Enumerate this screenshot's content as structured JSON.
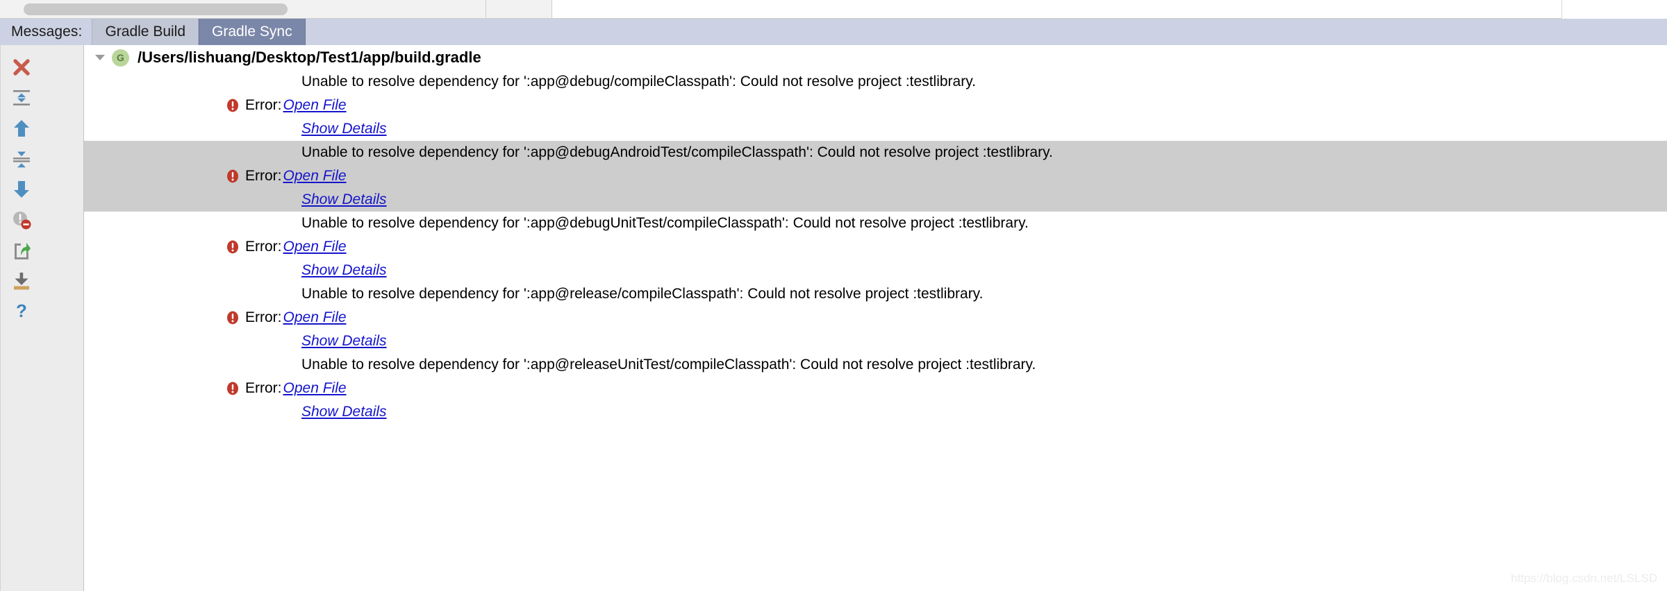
{
  "window": {
    "top_strip": {
      "pill_placeholder": ""
    }
  },
  "tabbar": {
    "label": "Messages:",
    "tabs": [
      {
        "label": "Gradle Build",
        "active": false
      },
      {
        "label": "Gradle Sync",
        "active": true
      }
    ]
  },
  "toolbar": {
    "items": [
      {
        "name": "close-icon",
        "tooltip": "Close"
      },
      {
        "name": "expand-all-icon",
        "tooltip": "Expand All"
      },
      {
        "name": "previous-occurrence-icon",
        "tooltip": "Previous Occurrence"
      },
      {
        "name": "collapse-all-icon",
        "tooltip": "Collapse All"
      },
      {
        "name": "next-occurrence-icon",
        "tooltip": "Next Occurrence"
      },
      {
        "name": "hide-warnings-icon",
        "tooltip": "Hide Warnings"
      },
      {
        "name": "export-icon",
        "tooltip": "Export to Text File"
      },
      {
        "name": "import-icon",
        "tooltip": "Scroll to Source"
      },
      {
        "name": "help-icon",
        "tooltip": "Help"
      }
    ]
  },
  "tree": {
    "root": {
      "badge": "G",
      "title": "/Users/lishuang/Desktop/Test1/app/build.gradle",
      "expanded": true
    },
    "error_label": "Error:",
    "open_file_label": "Open File",
    "show_details_label": "Show Details",
    "groups": [
      {
        "message": "Unable to resolve dependency for ':app@debug/compileClasspath': Could not resolve project :testlibrary.",
        "selected": false
      },
      {
        "message": "Unable to resolve dependency for ':app@debugAndroidTest/compileClasspath': Could not resolve project :testlibrary.",
        "selected": true
      },
      {
        "message": "Unable to resolve dependency for ':app@debugUnitTest/compileClasspath': Could not resolve project :testlibrary.",
        "selected": false
      },
      {
        "message": "Unable to resolve dependency for ':app@release/compileClasspath': Could not resolve project :testlibrary.",
        "selected": false
      },
      {
        "message": "Unable to resolve dependency for ':app@releaseUnitTest/compileClasspath': Could not resolve project :testlibrary.",
        "selected": false
      }
    ]
  },
  "watermark": "https://blog.csdn.net/LSLSD",
  "colors": {
    "tab_active_bg": "#7b87a8",
    "tab_inactive_bg": "#c2c7d6",
    "tabbar_bg": "#ccd2e3",
    "selection_bg": "#cdcdcd",
    "link": "#1414cc",
    "error_red": "#c0392b",
    "gradle_green": "#b9d69a",
    "toolbar_bg": "#ececed"
  }
}
